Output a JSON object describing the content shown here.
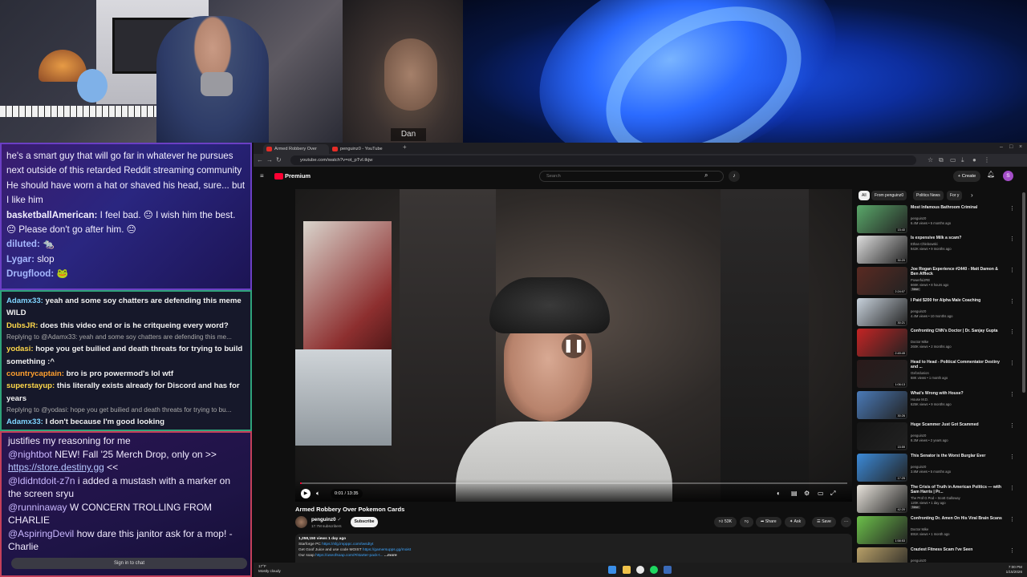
{
  "camera": {
    "guest_name": "Dan"
  },
  "chat_top": [
    {
      "user": "",
      "text": "he's a smart guy that will go far in whatever he pursues next outside of this retarded Reddit streaming community He should have worn a hat or shaved his head, sure... but I like him"
    },
    {
      "user": "basketballAmerican:",
      "text": "I feel bad. 😐 I wish him the best. 😐 Please don't go after him. 😐"
    },
    {
      "user": "diluted:",
      "text": "🐀"
    },
    {
      "user": "Lygar:",
      "text": "slop"
    },
    {
      "user": "Drugflood:",
      "text": "🐸"
    }
  ],
  "chat_mid": [
    {
      "user": "Adamx33:",
      "text": "yeah and some soy chatters are defending this meme WILD",
      "color": "#7fd4ff"
    },
    {
      "user": "DubsJR:",
      "text": "does this video end or is he critqueing every word?",
      "color": "#ffd84a"
    },
    {
      "reply": "Replying to @Adamx33: yeah and some soy chatters are defending this me..."
    },
    {
      "user": "yodasi:",
      "text": "hope you get builied and death threats for trying to build something :^",
      "color": "#ffd84a"
    },
    {
      "user": "countrycaptain:",
      "text": "bro is pro powermod's lol wtf",
      "color": "#ff9f2e"
    },
    {
      "user": "superstayup:",
      "text": "this literally exists already for Discord and has for years",
      "color": "#ffd84a"
    },
    {
      "reply": "Replying to @yodasi: hope you get builied and death threats for trying to bu..."
    },
    {
      "user": "Adamx33:",
      "text": "I don't because I'm good looking",
      "color": "#7fd4ff"
    }
  ],
  "chat_bot": {
    "line0": "justifies my reasoning for me",
    "messages": [
      {
        "user": "@nightbot",
        "text": "NEW! Fall '25 Merch Drop, only on >> ",
        "link": "https://store.destiny.gg",
        "after": " <<"
      },
      {
        "user": "@ldidntdoit-z7n",
        "text": "i added a mustash with a marker on the screen sryu"
      },
      {
        "user": "@runninaway",
        "text": "W CONCERN TROLLING FROM CHARLIE"
      },
      {
        "user": "@AspiringDevil",
        "text": "how dare this janitor ask for a mop! -Charlie"
      }
    ],
    "sign_in": "Sign in to chat"
  },
  "browser": {
    "tabs": [
      {
        "title": "Armed Robbery Over Poke..."
      },
      {
        "title": "penguinz0 - YouTube"
      }
    ],
    "url": "youtube.com/watch?v=ot_pTvI.tkjw"
  },
  "youtube": {
    "logo": "Premium",
    "search_placeholder": "Search",
    "create_label": "Create",
    "avatar_letter": "S",
    "video": {
      "title": "Armed Robbery Over Pokemon Cards",
      "time": "0:01 / 13:35",
      "progress": 0.001
    },
    "channel": {
      "name": "penguinz0",
      "subs": "17.7M subscribers",
      "subscribe": "Subscribe"
    },
    "actions": {
      "likes": "53K",
      "share": "Share",
      "ask": "Ask",
      "save": "Save"
    },
    "description": {
      "stats": "1,258,150 views  1 day ago",
      "l1_text": "Starforge PC ",
      "l1_link": "https://sfg.lmpppc.com/twsdtyt",
      "l2_text": "Get Goof Juice and use code MOIST ",
      "l2_link": "https://gamersupps.gg/moist",
      "l3_text": "Our soap ",
      "l3_link": "https://useofsoap.com/#/starter-pack-t...",
      "l3_more": "...more"
    },
    "chips": [
      "All",
      "From penguinz0",
      "Politics News",
      "For y"
    ],
    "recommendations": [
      {
        "title": "Most Infamous Bathroom Criminal",
        "channel": "penguinz0",
        "views": "6.4M views • 5 months ago",
        "duration": "15:40",
        "color": "#5aa86a",
        "new": ""
      },
      {
        "title": "Is expensive Milk a scam?",
        "channel": "Ethan Chlebowski",
        "views": "942K views • 9 months ago",
        "duration": "30:20",
        "color": "#dedede",
        "new": ""
      },
      {
        "title": "Joe Rogan Experience #2440 - Matt Damon & Ben Affleck",
        "channel": "PowerfulJRE",
        "views": "666K views • 8 hours ago",
        "duration": "2:24:07",
        "color": "#5a2a22",
        "new": "New"
      },
      {
        "title": "I Paid $200 for Alpha Male Coaching",
        "channel": "penguinz0",
        "views": "4.4M views • 10 months ago",
        "duration": "30:21",
        "color": "#c8d2dc",
        "new": ""
      },
      {
        "title": "Confronting CNN's Doctor | Dr. Sanjay Gupta",
        "channel": "Doctor Mike",
        "views": "260K views • 2 months ago",
        "duration": "2:49:49",
        "color": "#c42424",
        "new": ""
      },
      {
        "title": "Head to Head - Political Commentator Destiny and ...",
        "channel": "Oxfordunion",
        "views": "68K views • 1 month ago",
        "duration": "1:06:13",
        "color": "#2a1a1a",
        "new": ""
      },
      {
        "title": "What's Wrong with House?",
        "channel": "House M.D.",
        "views": "625K views • 9 months ago",
        "duration": "30:26",
        "color": "#4a7ab8",
        "new": ""
      },
      {
        "title": "Huge Scammer Just Got Scammed",
        "channel": "penguinz0",
        "views": "8.3M views • 2 years ago",
        "duration": "15:59",
        "color": "#151515",
        "new": ""
      },
      {
        "title": "This Senator is the Worst Burglar Ever",
        "channel": "penguinz0",
        "views": "3.8M views • 5 months ago",
        "duration": "17:25",
        "color": "#3c8ad8",
        "new": ""
      },
      {
        "title": "The Crisis of Truth in American Politics — with Sam Harris | Pr...",
        "channel": "The Prof G Pod – Scott Galloway",
        "views": "120K views • 1 day ago",
        "duration": "42:20",
        "color": "#e8e4dc",
        "new": "New"
      },
      {
        "title": "Confronting Dr. Amen On His Viral Brain Scans",
        "channel": "Doctor Mike",
        "views": "691K views • 1 month ago",
        "duration": "1:58:53",
        "color": "#6cc04a",
        "new": ""
      },
      {
        "title": "Craziest Fitness Scam I've Seen",
        "channel": "penguinz0",
        "views": "",
        "duration": "",
        "color": "#b8a068",
        "new": ""
      }
    ]
  },
  "taskbar": {
    "temp": "17°F",
    "weather": "Mostly cloudy",
    "time": "7:00 PM",
    "date": "1/15/2026"
  }
}
